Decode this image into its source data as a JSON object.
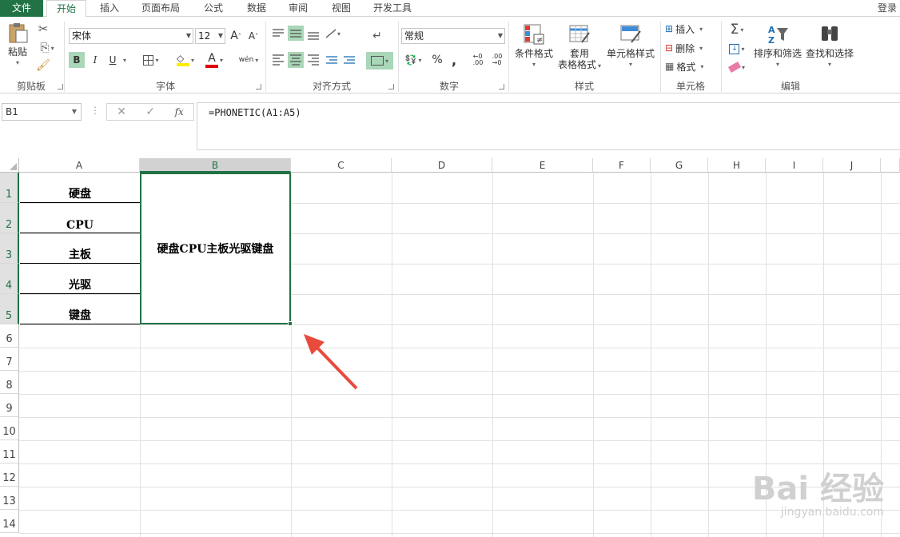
{
  "ribbon_tabs": [
    {
      "label": "文件"
    },
    {
      "label": "开始"
    },
    {
      "label": "插入"
    },
    {
      "label": "页面布局"
    },
    {
      "label": "公式"
    },
    {
      "label": "数据"
    },
    {
      "label": "审阅"
    },
    {
      "label": "视图"
    },
    {
      "label": "开发工具"
    }
  ],
  "login_label": "登录",
  "clipboard": {
    "paste_label": "粘贴",
    "group_label": "剪贴板"
  },
  "font": {
    "name": "宋体",
    "size": "12",
    "bold": "B",
    "italic": "I",
    "underline": "U",
    "group_label": "字体",
    "phonetic": "wén"
  },
  "alignment": {
    "group_label": "对齐方式"
  },
  "number": {
    "format": "常规",
    "percent": "%",
    "comma": ",",
    "group_label": "数字"
  },
  "styles": {
    "conditional": "条件格式",
    "table_line1": "套用",
    "table_line2": "表格格式",
    "cell_styles": "单元格样式",
    "group_label": "样式"
  },
  "cells": {
    "insert": "插入",
    "delete": "删除",
    "format": "格式",
    "group_label": "单元格"
  },
  "editing": {
    "sort": "排序和筛选",
    "find": "查找和选择",
    "group_label": "编辑"
  },
  "formula_bar": {
    "name_box": "B1",
    "fx": "fx",
    "formula": "=PHONETIC(A1:A5)"
  },
  "columns": [
    "A",
    "B",
    "C",
    "D",
    "E",
    "F",
    "G",
    "H",
    "I",
    "J"
  ],
  "rows": [
    "1",
    "2",
    "3",
    "4",
    "5",
    "6",
    "7",
    "8",
    "9",
    "10",
    "11",
    "12",
    "13",
    "14"
  ],
  "cells_a": [
    "硬盘",
    "CPU",
    "主板",
    "光驱",
    "键盘"
  ],
  "cell_b1": "硬盘CPU主板光驱键盘",
  "watermark": {
    "main": "Bai 经验",
    "sub": "jingyan.baidu.com"
  },
  "colors": {
    "accent": "#217346",
    "arrow": "#e84a3c"
  }
}
